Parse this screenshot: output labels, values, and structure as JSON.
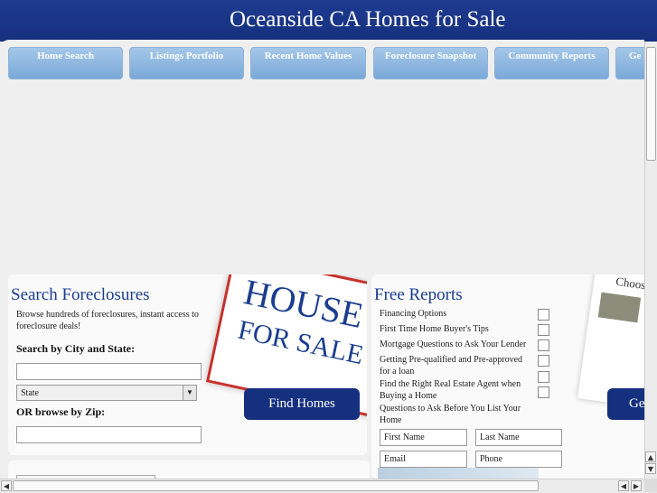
{
  "header": {
    "title": "Oceanside CA Homes for Sale"
  },
  "nav": [
    {
      "label": "Home Search"
    },
    {
      "label": "Listings Portfolio"
    },
    {
      "label": "Recent Home Values"
    },
    {
      "label": "Foreclosure Snapshot"
    },
    {
      "label": "Community Reports"
    },
    {
      "label": "Ge"
    }
  ],
  "search": {
    "title": "Search Foreclosures",
    "desc": "Browse hundreds of foreclosures, instant access to foreclosure deals!",
    "city_label": "Search by City and State:",
    "state_value": "State",
    "zip_label": "OR browse by Zip:",
    "button": "Find Homes",
    "image_word1": "HOUSE",
    "image_word2": "FOR SALE"
  },
  "reports": {
    "title": "Free Reports",
    "items": [
      "Financing Options",
      "First Time Home Buyer's Tips",
      "Mortgage Questions to Ask Your Lender",
      "Getting Pre-qualified and Pre-approved for a loan",
      "Find the Right Real Estate Agent when Buying a Home",
      "Questions to Ask Before You List Your Home"
    ],
    "first_name": "First Name",
    "last_name": "Last Name",
    "email": "Email",
    "phone": "Phone",
    "button": "Ge",
    "image_word": "Choosing"
  }
}
